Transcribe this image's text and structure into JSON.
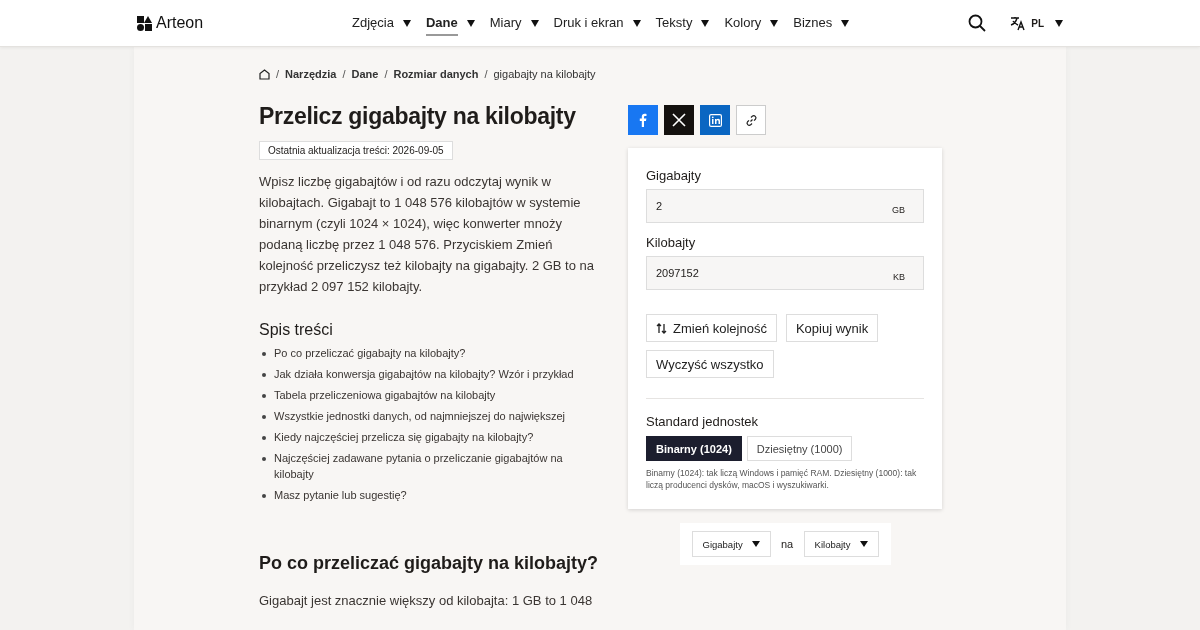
{
  "header": {
    "logo": "Arteon",
    "nav": [
      {
        "label": "Zdjęcia",
        "selected": false
      },
      {
        "label": "Dane",
        "selected": true
      },
      {
        "label": "Miary",
        "selected": false
      },
      {
        "label": "Druk i ekran",
        "selected": false
      },
      {
        "label": "Teksty",
        "selected": false
      },
      {
        "label": "Kolory",
        "selected": false
      },
      {
        "label": "Biznes",
        "selected": false
      }
    ],
    "language": "PL"
  },
  "breadcrumbs": [
    "Narzędzia",
    "Dane",
    "Rozmiar danych",
    "gigabajty na kilobajty"
  ],
  "breadcrumb_separator": "/",
  "title": "Przelicz gigabajty na kilobajty",
  "updated": "Ostatnia aktualizacja treści: 2026-09-05",
  "intro": "Wpisz liczbę gigabajtów i od razu odczytaj wynik w kilobajtach. Gigabajt to 1 048 576 kilobajtów w systemie binarnym (czyli 1024 × 1024), więc konwerter mnoży podaną liczbę przez 1 048 576. Przyciskiem Zmień kolejność przeliczysz też kilobajty na gigabajty. 2 GB to na przykład 2 097 152 kilobajty.",
  "toc": {
    "title": "Spis treści",
    "items": [
      "Po co przeliczać gigabajty na kilobajty?",
      "Jak działa konwersja gigabajtów na kilobajty? Wzór i przykład",
      "Tabela przeliczeniowa gigabajtów na kilobajty",
      "Wszystkie jednostki danych, od najmniejszej do największej",
      "Kiedy najczęściej przelicza się gigabajty na kilobajty?",
      "Najczęściej zadawane pytania o przeliczanie gigabajtów na kilobajty",
      "Masz pytanie lub sugestię?"
    ]
  },
  "section": {
    "heading": "Po co przeliczać gigabajty na kilobajty?",
    "text": "Gigabajt jest znacznie większy od kilobajta: 1 GB to 1 048"
  },
  "share": [
    {
      "kind": "facebook"
    },
    {
      "kind": "x"
    },
    {
      "kind": "linkedin"
    },
    {
      "kind": "link"
    }
  ],
  "converter": {
    "fields": [
      {
        "label": "Gigabajty",
        "value": "2",
        "unit": "GB"
      },
      {
        "label": "Kilobajty",
        "value": "2097152",
        "unit": "KB"
      }
    ],
    "buttons": [
      {
        "label": "Zmień kolejność",
        "kind": "swap"
      },
      {
        "label": "Kopiuj wynik",
        "kind": "plain"
      },
      {
        "label": "Wyczyść wszystko",
        "kind": "plain"
      }
    ],
    "standard": {
      "label": "Standard jednostek",
      "options": [
        {
          "label": "Binarny (1024)",
          "selected": true
        },
        {
          "label": "Dziesiętny (1000)",
          "selected": false
        }
      ],
      "note": "Binarny (1024): tak liczą Windows i pamięć RAM. Dziesiętny (1000): tak liczą producenci dysków, macOS i wyszukiwarki."
    }
  },
  "unit_picker": {
    "from": "Gigabajty",
    "joiner": "na",
    "to": "Kilobajty"
  }
}
